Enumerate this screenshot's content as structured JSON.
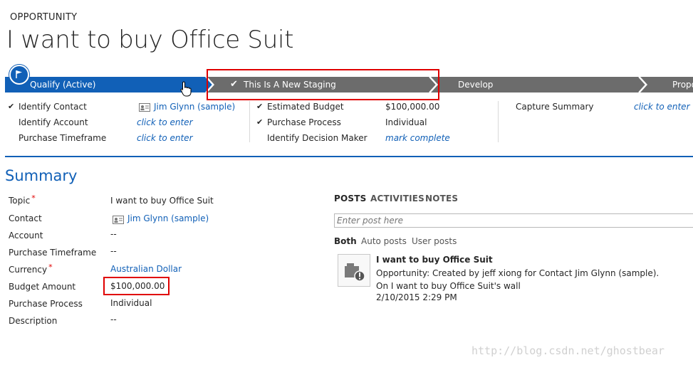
{
  "header": {
    "entity_type": "OPPORTUNITY",
    "title": "I want to buy Office Suit"
  },
  "process": {
    "stages": [
      {
        "label": "Qualify (Active)",
        "state": "active"
      },
      {
        "label": "This Is A New Staging",
        "state": "completed"
      },
      {
        "label": "Develop",
        "state": "pending"
      },
      {
        "label": "Propo",
        "state": "pending"
      }
    ],
    "active_color": "#1160b7",
    "inactive_color": "#6c6c6c",
    "fields_col1": [
      {
        "label": "Identify Contact",
        "value": "Jim Glynn (sample)",
        "checked": true
      },
      {
        "label": "Identify Account",
        "value": "click to enter",
        "checked": false
      },
      {
        "label": "Purchase Timeframe",
        "value": "click to enter",
        "checked": false
      }
    ],
    "fields_col2": [
      {
        "label": "Estimated Budget",
        "value": "$100,000.00",
        "checked": true
      },
      {
        "label": "Purchase Process",
        "value": "Individual",
        "checked": true
      },
      {
        "label": "Identify Decision Maker",
        "value": "mark complete",
        "checked": false
      }
    ],
    "fields_col3": [
      {
        "label": "Capture Summary",
        "value": "click to enter",
        "checked": false
      }
    ]
  },
  "summary": {
    "heading": "Summary",
    "fields": [
      {
        "label": "Topic",
        "value": "I want to buy Office Suit",
        "required": true
      },
      {
        "label": "Contact",
        "value": "Jim Glynn (sample)",
        "required": false
      },
      {
        "label": "Account",
        "value": "--",
        "required": false
      },
      {
        "label": "Purchase Timeframe",
        "value": "--",
        "required": false
      },
      {
        "label": "Currency",
        "value": "Australian Dollar",
        "required": true
      },
      {
        "label": "Budget Amount",
        "value": "$100,000.00",
        "required": false
      },
      {
        "label": "Purchase Process",
        "value": "Individual",
        "required": false
      },
      {
        "label": "Description",
        "value": "--",
        "required": false
      }
    ],
    "required_mark": "*"
  },
  "social": {
    "tabs": [
      "POSTS",
      "ACTIVITIES",
      "NOTES"
    ],
    "post_placeholder": "Enter post here",
    "filters": [
      "Both",
      "Auto posts",
      "User posts"
    ],
    "post": {
      "title": "I want to buy Office Suit",
      "line1_prefix": "Opportunity: Created by ",
      "author": "jeff xiong",
      "line1_suffix": " for Contact Jim Glynn (sample).",
      "line2": "On I want to buy Office Suit's wall",
      "timestamp": "2/10/2015 2:29 PM"
    }
  },
  "watermark": "http://blog.csdn.net/ghostbear"
}
